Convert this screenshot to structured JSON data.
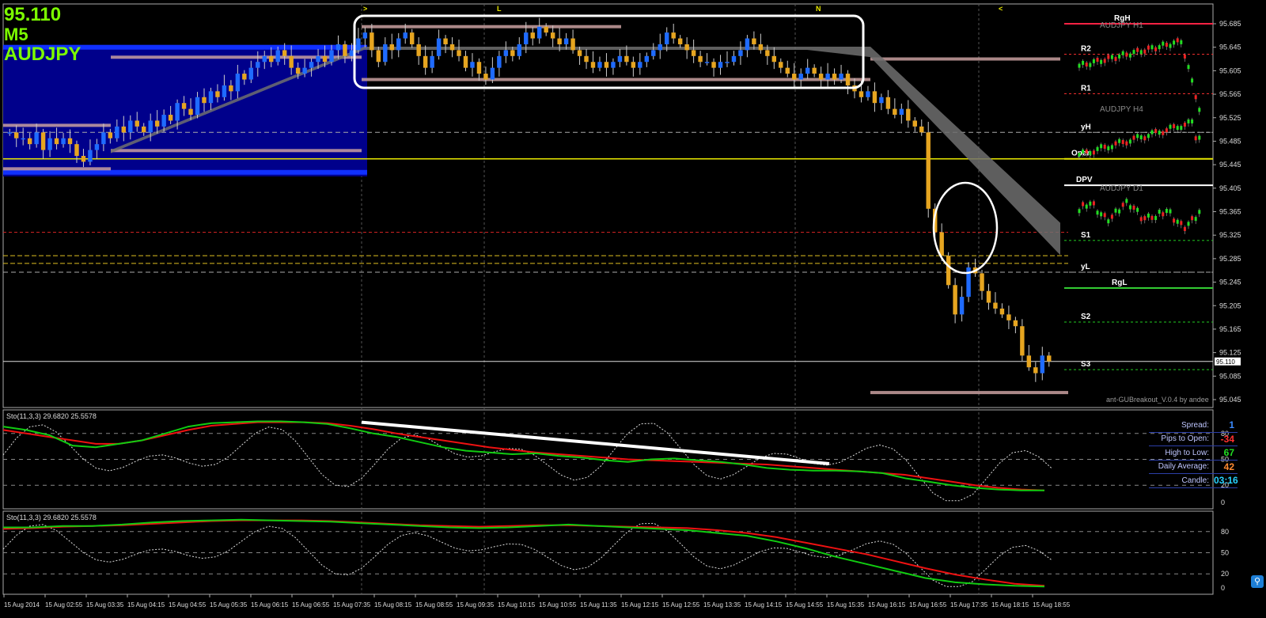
{
  "header": {
    "price": "95.110",
    "timeframe": "M5",
    "symbol": "AUDJPY"
  },
  "colors": {
    "bull": "#1f6bff",
    "bear": "#e6a520",
    "mini_bull": "#22dd22",
    "mini_bear": "#ee2222",
    "stoch_main": "#11cc11",
    "stoch_signal": "#ee1111",
    "box_blue": "#00008b",
    "open_line": "#e8e800",
    "rgh": "#ff2244",
    "rgl": "#33cc33"
  },
  "chart_data": {
    "type": "candlestick",
    "symbol": "AUDJPY",
    "timeframe": "M5",
    "y_axis": {
      "min": 95.045,
      "max": 95.685,
      "ticks": [
        "95.685",
        "95.645",
        "95.605",
        "95.565",
        "95.525",
        "95.485",
        "95.445",
        "95.405",
        "95.365",
        "95.325",
        "95.285",
        "95.245",
        "95.205",
        "95.165",
        "95.125",
        "95.085",
        "95.045"
      ]
    },
    "current_price": "95.110",
    "x_labels": [
      "15 Aug 2014",
      "15 Aug 02:55",
      "15 Aug 03:35",
      "15 Aug 04:15",
      "15 Aug 04:55",
      "15 Aug 05:35",
      "15 Aug 06:15",
      "15 Aug 06:55",
      "15 Aug 07:35",
      "15 Aug 08:15",
      "15 Aug 08:55",
      "15 Aug 09:35",
      "15 Aug 10:15",
      "15 Aug 10:55",
      "15 Aug 11:35",
      "15 Aug 12:15",
      "15 Aug 12:55",
      "15 Aug 13:35",
      "15 Aug 14:15",
      "15 Aug 14:55",
      "15 Aug 15:35",
      "15 Aug 16:15",
      "15 Aug 16:55",
      "15 Aug 17:35",
      "15 Aug 18:15",
      "15 Aug 18:55"
    ],
    "session_markers": [
      ">",
      "L",
      "N",
      "<"
    ],
    "closes": [
      95.5,
      95.49,
      95.49,
      95.48,
      95.5,
      95.47,
      95.49,
      95.48,
      95.49,
      95.48,
      95.46,
      95.45,
      95.47,
      95.48,
      95.5,
      95.49,
      95.51,
      95.5,
      95.52,
      95.51,
      95.5,
      95.52,
      95.51,
      95.53,
      95.52,
      95.55,
      95.54,
      95.53,
      95.56,
      95.55,
      95.57,
      95.56,
      95.58,
      95.57,
      95.6,
      95.59,
      95.61,
      95.62,
      95.63,
      95.62,
      95.64,
      95.63,
      95.61,
      95.6,
      95.61,
      95.62,
      95.63,
      95.62,
      95.64,
      95.65,
      95.63,
      95.64,
      95.66,
      95.67,
      95.64,
      95.62,
      95.65,
      95.64,
      95.66,
      95.67,
      95.65,
      95.63,
      95.61,
      95.63,
      95.66,
      95.65,
      95.64,
      95.63,
      95.61,
      95.62,
      95.6,
      95.59,
      95.61,
      95.63,
      95.64,
      95.63,
      95.65,
      95.67,
      95.66,
      95.68,
      95.67,
      95.66,
      95.65,
      95.66,
      95.64,
      95.63,
      95.62,
      95.61,
      95.62,
      95.61,
      95.62,
      95.63,
      95.62,
      95.61,
      95.62,
      95.63,
      95.64,
      95.65,
      95.67,
      95.66,
      95.65,
      95.64,
      95.63,
      95.62,
      95.62,
      95.61,
      95.62,
      95.62,
      95.63,
      95.64,
      95.66,
      95.65,
      95.64,
      95.63,
      95.62,
      95.61,
      95.6,
      95.59,
      95.6,
      95.61,
      95.6,
      95.59,
      95.6,
      95.59,
      95.6,
      95.58,
      95.57,
      95.56,
      95.57,
      95.55,
      95.56,
      95.54,
      95.53,
      95.54,
      95.52,
      95.51,
      95.5,
      95.37,
      95.33,
      95.29,
      95.24,
      95.19,
      95.22,
      95.27,
      95.26,
      95.23,
      95.21,
      95.2,
      95.19,
      95.18,
      95.17,
      95.12,
      95.1,
      95.09,
      95.12,
      95.11
    ],
    "overlay_levels": [
      {
        "label": "RgH",
        "value": 95.685
      },
      {
        "label": "R2",
        "value": 95.633
      },
      {
        "label": "R1",
        "value": 95.566
      },
      {
        "label": "yH",
        "value": 95.5
      },
      {
        "label": "Open",
        "value": 95.455
      },
      {
        "label": "DPV",
        "value": 95.41
      },
      {
        "label": "S1",
        "value": 95.316
      },
      {
        "label": "yL",
        "value": 95.262
      },
      {
        "label": "RgL",
        "value": 95.235
      },
      {
        "label": "S2",
        "value": 95.177
      },
      {
        "label": "S3",
        "value": 95.096
      }
    ],
    "mini_charts": [
      "AUDJPY H1",
      "AUDJPY H4",
      "AUDJPY D1"
    ],
    "ea_label": "ant-GUBreakout_V.0.4 by andee",
    "stochastic_1": {
      "label": "Sto(11,3,3) 29.6820 25.5578",
      "levels": [
        "80",
        "50",
        "20",
        "0"
      ],
      "main": [
        88,
        84,
        78,
        66,
        64,
        68,
        72,
        80,
        88,
        92,
        93,
        94,
        94,
        93,
        91,
        86,
        80,
        76,
        70,
        64,
        60,
        58,
        56,
        57,
        54,
        52,
        49,
        47,
        50,
        51,
        49,
        47,
        44,
        40,
        38,
        37,
        37,
        36,
        34,
        28,
        24,
        20,
        17,
        15,
        14,
        14
      ],
      "signal": [
        84,
        80,
        76,
        72,
        68,
        68,
        72,
        78,
        84,
        89,
        91,
        93,
        93,
        93,
        92,
        89,
        85,
        80,
        76,
        72,
        68,
        64,
        61,
        58,
        56,
        54,
        52,
        50,
        49,
        48,
        47,
        46,
        45,
        44,
        42,
        40,
        38,
        36,
        34,
        32,
        28,
        24,
        20,
        17,
        15,
        14
      ]
    },
    "stochastic_2": {
      "label": "Sto(11,3,3) 29.6820 25.5578",
      "levels": [
        "80",
        "50",
        "20",
        "0"
      ],
      "main": [
        86,
        86,
        88,
        88,
        90,
        93,
        95,
        96,
        97,
        96,
        95,
        94,
        92,
        90,
        88,
        86,
        85,
        86,
        88,
        90,
        88,
        86,
        84,
        82,
        78,
        74,
        66,
        56,
        44,
        34,
        24,
        14,
        8,
        5,
        3,
        2
      ],
      "signal": [
        84,
        85,
        87,
        88,
        89,
        91,
        93,
        95,
        96,
        96,
        96,
        95,
        93,
        91,
        89,
        88,
        87,
        88,
        89,
        89,
        88,
        87,
        86,
        85,
        82,
        78,
        72,
        64,
        56,
        48,
        38,
        28,
        19,
        12,
        6,
        3
      ]
    },
    "info_panel": [
      {
        "label": "Spread:",
        "value": "1",
        "color": "#3b8bff"
      },
      {
        "label": "Pips to Open:",
        "value": "-34",
        "color": "#ff3030"
      },
      {
        "label": "High to Low:",
        "value": "67",
        "color": "#22dd22"
      },
      {
        "label": "Daily Average:",
        "value": "42",
        "color": "#ff8a30"
      },
      {
        "label": "Candle:",
        "value": "03:16",
        "color": "#27d2ff"
      }
    ]
  }
}
